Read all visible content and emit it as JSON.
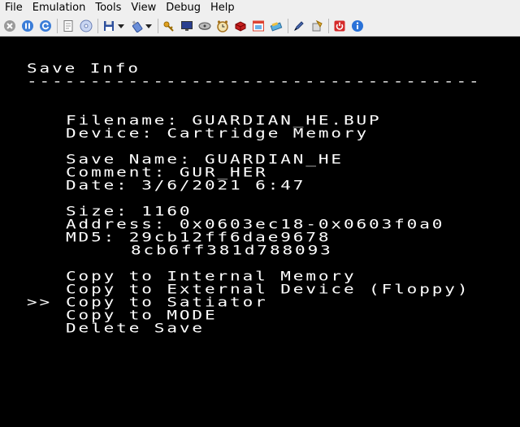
{
  "menu": {
    "items": [
      "File",
      "Emulation",
      "Tools",
      "View",
      "Debug",
      "Help"
    ]
  },
  "toolbar": {
    "icons": [
      "close-circle-icon",
      "pause-circle-icon",
      "refresh-circle-icon",
      "document-icon",
      "disc-icon",
      "floppy-save-icon",
      "usb-drive-icon",
      "key-icon",
      "monitor-icon",
      "cd-drive-icon",
      "clock-icon",
      "cartridge-icon",
      "window-icon",
      "chip-icon",
      "pen-icon",
      "package-icon",
      "power-icon",
      "info-icon"
    ]
  },
  "screen": {
    "title": "Save Info",
    "divider": "------------------------------------",
    "filename": "Filename: GUARDIAN_HE.BUP",
    "device": "Device: Cartridge Memory",
    "save_name": "Save Name: GUARDIAN_HE",
    "comment": "Comment: GUR_HER",
    "date": "Date: 3/6/2021 6:47",
    "size": "Size: 1160",
    "address": "Address: 0x0603ec18-0x0603f0a0",
    "md5_line1": "MD5: 29cb12ff6dae9678",
    "md5_line2": "8cb6ff381d788093",
    "cursor": ">>",
    "options": [
      "Copy to Internal Memory",
      "Copy to External Device (Floppy)",
      "Copy to Satiator",
      "Copy to MODE",
      "Delete Save"
    ]
  }
}
